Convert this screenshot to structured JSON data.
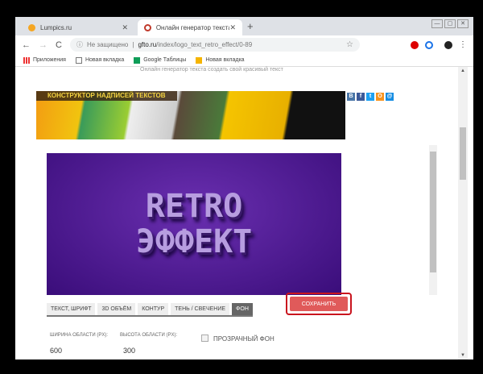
{
  "browser": {
    "tabs": [
      {
        "title": "Lumpics.ru",
        "color": "#f5a623"
      },
      {
        "title": "Онлайн генератор текста созд",
        "color": "#c0392b"
      }
    ],
    "address": {
      "security": "Не защищено",
      "host": "gfto.ru",
      "path": "/index/logo_text_retro_effect/0-89"
    },
    "bookmarks": [
      "Приложения",
      "Новая вкладка",
      "Google Таблицы",
      "Новая вкладка"
    ]
  },
  "page": {
    "top_text": "Онлайн генератор текста создать свой красивый текст",
    "banner_title": "КОНСТРУКТОР НАДПИСЕЙ ТЕКСТОВ",
    "share": [
      {
        "label": "В",
        "color": "#4a76a8"
      },
      {
        "label": "f",
        "color": "#3b5998"
      },
      {
        "label": "t",
        "color": "#1da1f2"
      },
      {
        "label": "О",
        "color": "#f7931e"
      },
      {
        "label": "@",
        "color": "#168de2"
      }
    ],
    "preview": {
      "line1": "RETRO",
      "line2": "ЭФФЕКТ"
    },
    "tabs": [
      "ТЕКСТ, ШРИФТ",
      "3D ОБЪЁМ",
      "КОНТУР",
      "ТЕНЬ / СВЕЧЕНИЕ",
      "ФОН"
    ],
    "active_tab": "ФОН",
    "save_label": "СОХРАНИТЬ",
    "width_label": "ШИРИНА ОБЛАСТИ (PX):",
    "width_value": "600",
    "height_label": "ВЫСОТА ОБЛАСТИ (PX):",
    "height_value": "300",
    "transparent_label": "ПРОЗРАЧНЫЙ ФОН"
  }
}
